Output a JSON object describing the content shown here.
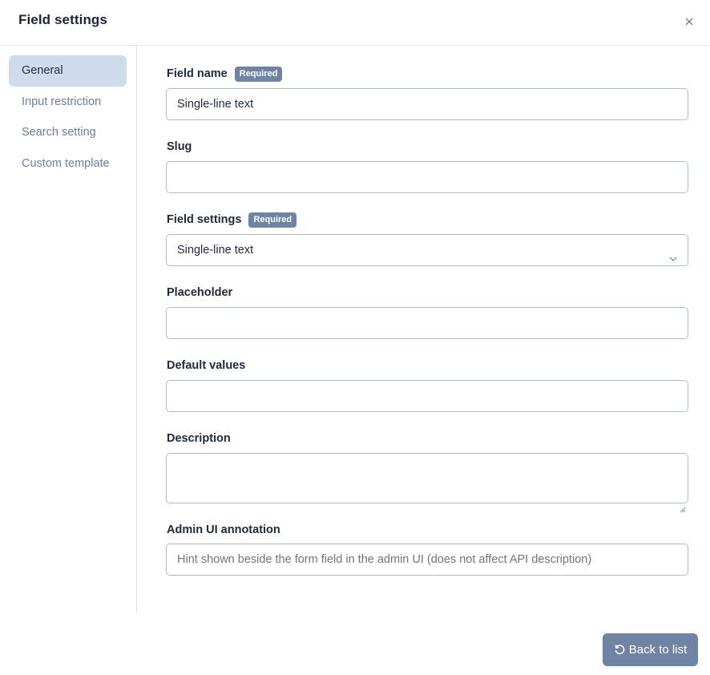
{
  "dialog": {
    "title": "Field settings",
    "close_icon": "close-icon"
  },
  "sidebar": {
    "items": [
      {
        "label": "General",
        "active": true
      },
      {
        "label": "Input restriction",
        "active": false
      },
      {
        "label": "Search setting",
        "active": false
      },
      {
        "label": "Custom template",
        "active": false
      }
    ]
  },
  "form": {
    "field_name": {
      "label": "Field name",
      "badge": "Required",
      "value": "Single-line text"
    },
    "slug": {
      "label": "Slug",
      "value": ""
    },
    "field_settings": {
      "label": "Field settings",
      "badge": "Required",
      "value": "Single-line text"
    },
    "placeholder": {
      "label": "Placeholder",
      "value": ""
    },
    "default_values": {
      "label": "Default values",
      "value": ""
    },
    "description": {
      "label": "Description",
      "value": ""
    },
    "admin_ui_annotation": {
      "label": "Admin UI annotation",
      "value": "",
      "placeholder": "Hint shown beside the form field in the admin UI (does not affect API description)"
    }
  },
  "footer": {
    "back_label": "Back to list",
    "back_icon": "undo-icon"
  },
  "colors": {
    "accent": "#6f84a3",
    "active_nav": "#cfdcec",
    "border": "#aebccc"
  }
}
